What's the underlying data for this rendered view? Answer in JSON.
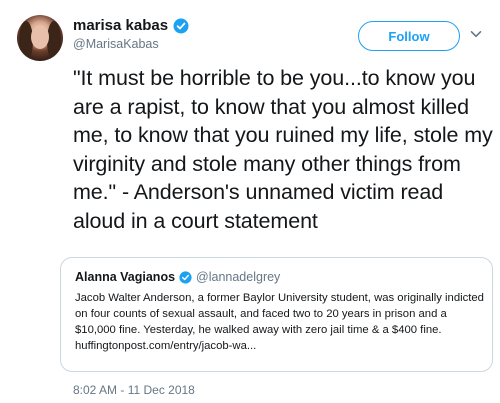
{
  "author": {
    "display_name": "marisa kabas",
    "handle": "@MarisaKabas",
    "verified": true
  },
  "follow_button": {
    "label": "Follow"
  },
  "tweet": {
    "text": "\"It must be horrible to be you...to know you are a rapist, to know that you almost killed me, to know that you ruined my life, stole my virginity and stole many other things from me.\" - Anderson's unnamed victim read aloud in a court statement",
    "timestamp": "8:02 AM - 11 Dec 2018"
  },
  "quoted_tweet": {
    "display_name": "Alanna Vagianos",
    "handle": "@lannadelgrey",
    "verified": true,
    "text": "Jacob Walter Anderson, a former Baylor University student, was originally indicted on four counts of sexual assault, and faced two to 20 years in prison and a $10,000 fine. Yesterday, he walked away with zero jail time & a $400 fine. huffingtonpost.com/entry/jacob-wa..."
  },
  "colors": {
    "accent": "#1da1f2",
    "secondary_text": "#657786",
    "border": "#ccd6dd",
    "text": "#14171a"
  },
  "icons": {
    "verified": "verified-badge-icon",
    "menu": "chevron-down-icon"
  }
}
